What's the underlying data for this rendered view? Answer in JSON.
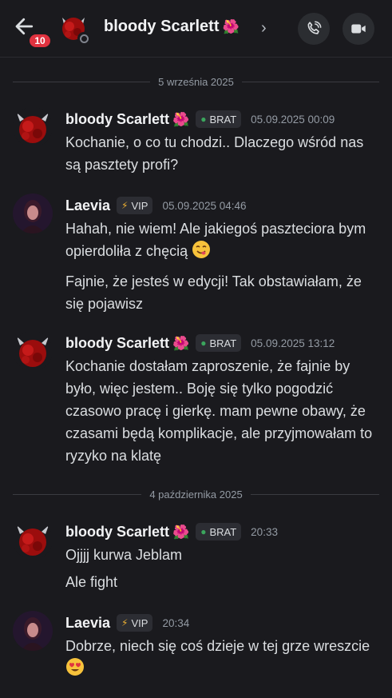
{
  "header": {
    "title": "bloody Scarlett",
    "title_emoji": "🌺",
    "unread_count": "10",
    "chevron": "›"
  },
  "dividers": [
    "5 września 2025",
    "4 października 2025"
  ],
  "messages": [
    {
      "author": "bloody Scarlett",
      "author_emoji": "🌺",
      "tag": "BRAT",
      "tag_icon": "leaf-icon",
      "time": "05.09.2025 00:09",
      "lines": [
        "Kochanie, o co tu chodzi.. Dlaczego wśród nas są pasztety profi?"
      ]
    },
    {
      "author": "Laevia",
      "tag": "VIP",
      "tag_icon": "lightning-icon",
      "time": "05.09.2025 04:46",
      "lines": [
        "Hahah,  nie wiem! Ale jakiegoś paszteciora bym opierdoliła z chęcią",
        "Fajnie, że jesteś w edycji! Tak obstawiałam, że się pojawisz"
      ],
      "emoji_after_first": "yummy-face-icon"
    },
    {
      "author": "bloody Scarlett",
      "author_emoji": "🌺",
      "tag": "BRAT",
      "tag_icon": "leaf-icon",
      "time": "05.09.2025 13:12",
      "lines": [
        "Kochanie dostałam zaproszenie, że fajnie by było, więc jestem.. Boję się tylko pogodzić czasowo pracę i gierkę. mam pewne obawy, że czasami będą komplikacje, ale przyjmowałam to ryzyko na klatę"
      ]
    },
    {
      "author": "bloody Scarlett",
      "author_emoji": "🌺",
      "tag": "BRAT",
      "tag_icon": "leaf-icon",
      "time": "20:33",
      "lines": [
        "Ojjjj kurwa Jeblam",
        "Ale fight"
      ]
    },
    {
      "author": "Laevia",
      "tag": "VIP",
      "tag_icon": "lightning-icon",
      "time": "20:34",
      "lines": [
        "Dobrze, niech się coś dzieje w tej grze wreszcie"
      ],
      "emoji_after_first": "heart-eyes-icon"
    }
  ],
  "colors": {
    "background": "#1a1a1e",
    "badge": "#e0323f",
    "brat_leaf": "#3ba55d",
    "vip_bolt": "#f0b232"
  }
}
